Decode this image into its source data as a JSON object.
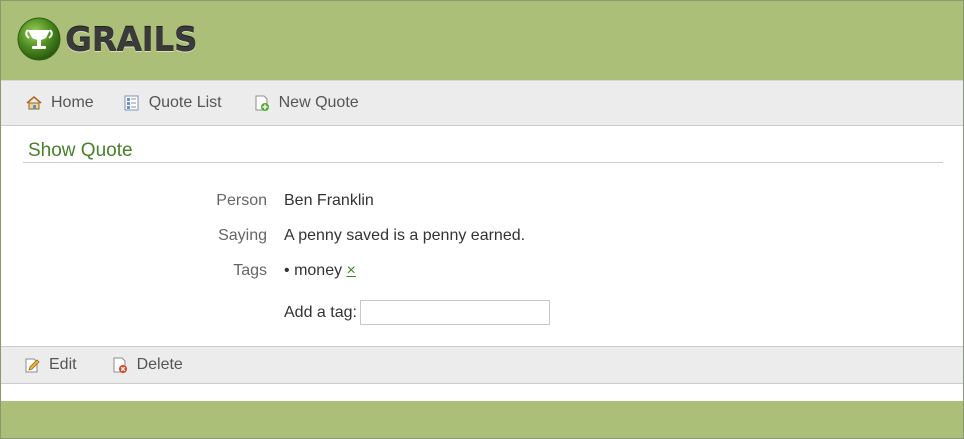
{
  "brand": {
    "name": "GRAILS"
  },
  "nav": {
    "items": [
      {
        "label": "Home",
        "icon": "house-icon"
      },
      {
        "label": "Quote List",
        "icon": "list-document-icon"
      },
      {
        "label": "New Quote",
        "icon": "new-document-icon"
      }
    ]
  },
  "page": {
    "title": "Show Quote"
  },
  "fields": {
    "person": {
      "label": "Person",
      "value": "Ben Franklin"
    },
    "saying": {
      "label": "Saying",
      "value": "A penny saved is a penny earned."
    },
    "tags": {
      "label": "Tags",
      "items": [
        {
          "bullet": "•",
          "name": "money",
          "remove": "×"
        }
      ],
      "add_label": "Add a tag:",
      "add_value": ""
    }
  },
  "actions": {
    "edit": {
      "label": "Edit",
      "icon": "pencil-edit-icon"
    },
    "delete": {
      "label": "Delete",
      "icon": "delete-document-icon"
    }
  },
  "colors": {
    "header_bg": "#abbf78",
    "title_green": "#48802c",
    "bar_bg": "#ececec"
  }
}
